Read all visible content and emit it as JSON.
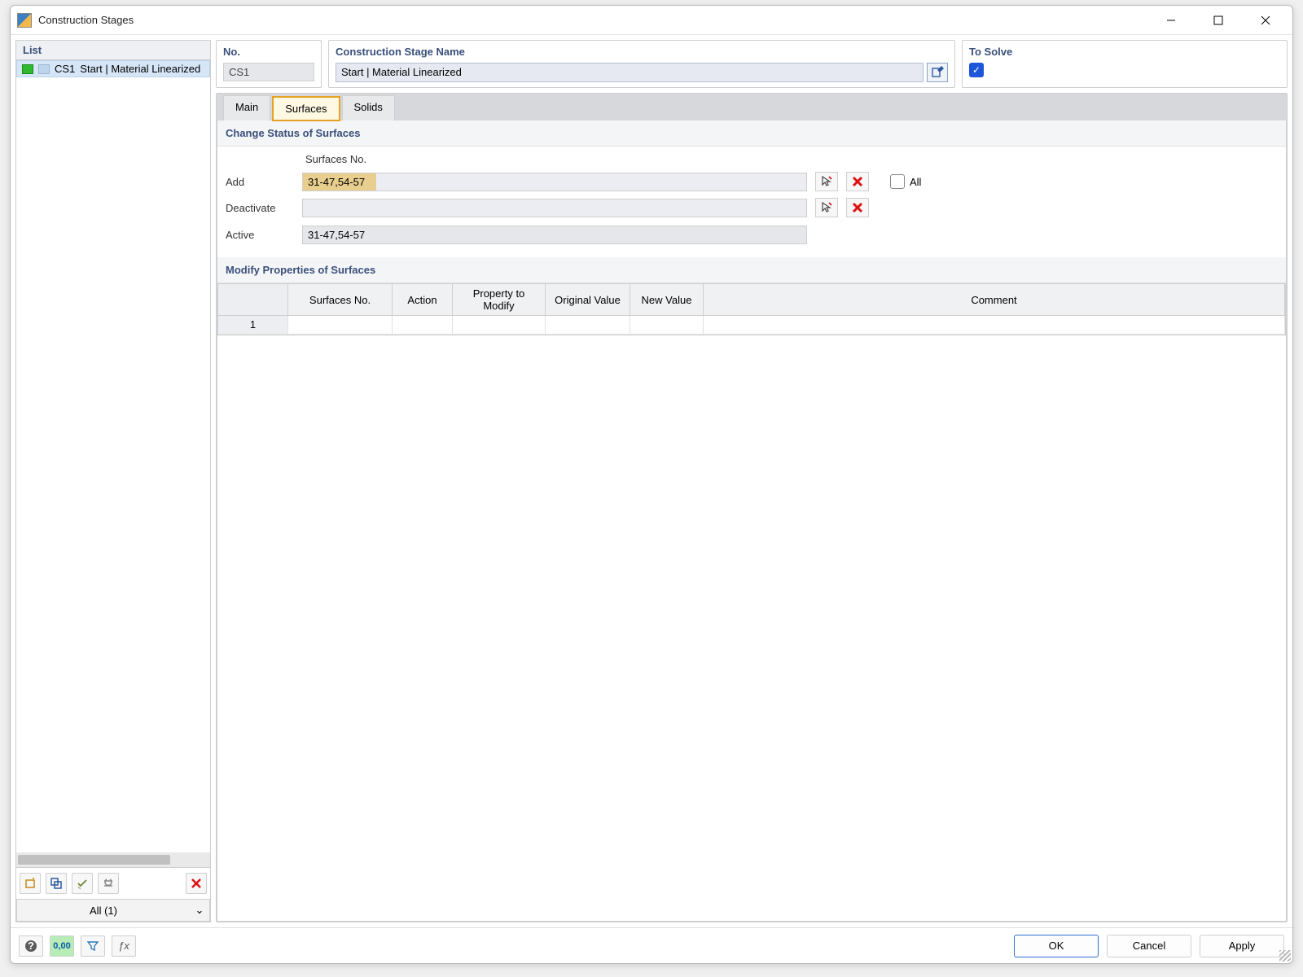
{
  "window": {
    "title": "Construction Stages"
  },
  "left": {
    "list_header": "List",
    "items": [
      {
        "code": "CS1",
        "label": "Start | Material Linearized"
      }
    ],
    "filter": "All (1)",
    "toolbar_names": {
      "new": "new",
      "copy": "copy",
      "include": "include",
      "exclude": "exclude",
      "delete": "delete"
    }
  },
  "top": {
    "no_label": "No.",
    "no_value": "CS1",
    "name_label": "Construction Stage Name",
    "name_value": "Start | Material Linearized",
    "solve_label": "To Solve",
    "solve_checked": true
  },
  "tabs": {
    "main": "Main",
    "surfaces": "Surfaces",
    "solids": "Solids",
    "active": "surfaces"
  },
  "status": {
    "title": "Change Status of Surfaces",
    "col_header": "Surfaces No.",
    "rows": {
      "add_label": "Add",
      "add_value": "31-47,54-57",
      "deact_label": "Deactivate",
      "deact_value": "",
      "active_label": "Active",
      "active_value": "31-47,54-57"
    },
    "all_label": "All"
  },
  "modify": {
    "title": "Modify Properties of Surfaces",
    "headers": {
      "rownum": "",
      "surfaces": "Surfaces No.",
      "action": "Action",
      "property": "Property to Modify",
      "original": "Original Value",
      "new": "New Value",
      "comment": "Comment"
    },
    "rows": [
      {
        "n": "1",
        "surfaces": "",
        "action": "",
        "property": "",
        "original": "",
        "new": "",
        "comment": ""
      }
    ]
  },
  "footer": {
    "ok": "OK",
    "cancel": "Cancel",
    "apply": "Apply"
  }
}
